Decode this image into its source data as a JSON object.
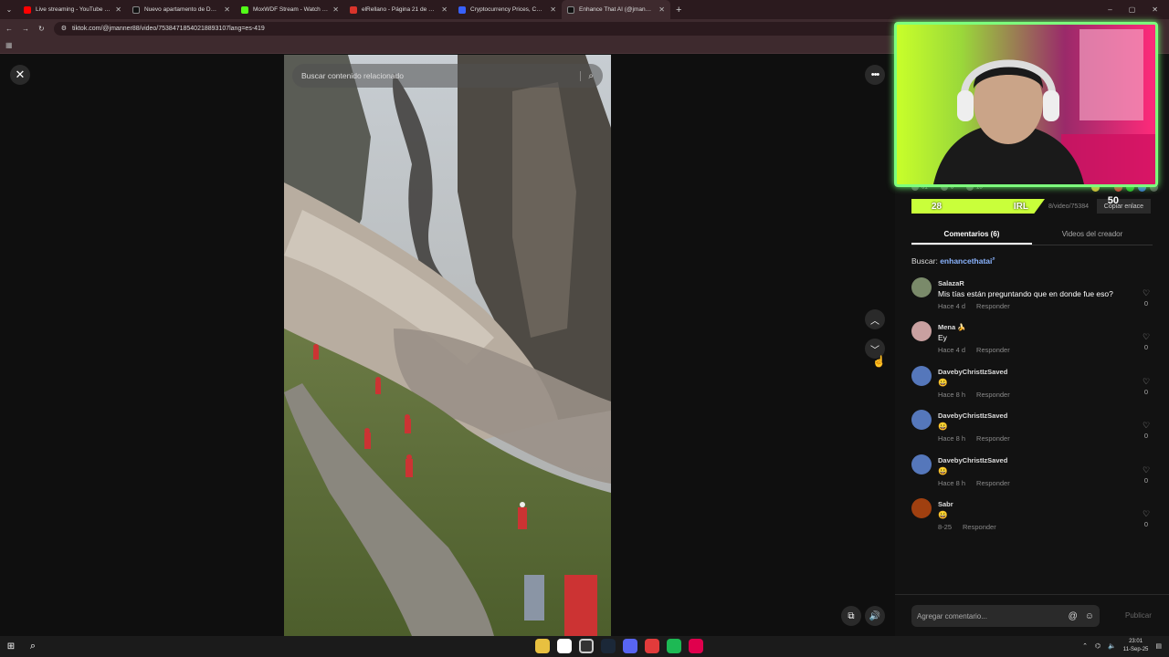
{
  "browser": {
    "tabs": [
      {
        "title": "Live streaming - YouTube Studio",
        "color": "#ff0000"
      },
      {
        "title": "Nuevo apartamento de Daarick",
        "color": "#000000"
      },
      {
        "title": "MoxWDF Stream - Watch Live on",
        "color": "#53fc18"
      },
      {
        "title": "elRellano - Página 21 de 5725",
        "color": "#d9342b"
      },
      {
        "title": "Cryptocurrency Prices, Charts A",
        "color": "#3861fb"
      },
      {
        "title": "Enhance That AI (@jmanner8",
        "color": "#000000",
        "active": true
      }
    ],
    "url": "tiktok.com/@jmanner88/video/75384718540218893107lang=es-419",
    "window": {
      "min": "–",
      "max": "▢",
      "close": "✕"
    }
  },
  "player": {
    "search_placeholder": "Buscar contenido relacionado",
    "more": "•••",
    "up": "︿",
    "down": "﹀",
    "close": "✕"
  },
  "panel": {
    "stats": [
      "61",
      "6",
      "13",
      "1/7"
    ],
    "overlay_left": "28",
    "overlay_right": "IRL",
    "link_text": "8/video/75384",
    "copy_label": "Copiar enlace",
    "copy_number": "50",
    "tabs": {
      "comments": "Comentarios (6)",
      "creator": "Videos del creador"
    },
    "search_prefix": "Buscar:",
    "search_query": "enhancethatai",
    "comments": [
      {
        "user": "SalazaR",
        "text": "Mis tías están preguntando que en donde fue eso?",
        "time": "Hace 4 d",
        "reply": "Responder",
        "likes": "0",
        "avatar_color": "#7a8a6a"
      },
      {
        "user": "Mena 🍌",
        "text": "Ey",
        "time": "Hace 4 d",
        "reply": "Responder",
        "likes": "0",
        "avatar_color": "#c9a0a0"
      },
      {
        "user": "DavebyChristIzSaved",
        "text": "😀",
        "time": "Hace 8 h",
        "reply": "Responder",
        "likes": "0",
        "avatar_color": "#5577bb"
      },
      {
        "user": "DavebyChristIzSaved",
        "text": "😀",
        "time": "Hace 8 h",
        "reply": "Responder",
        "likes": "0",
        "avatar_color": "#5577bb"
      },
      {
        "user": "DavebyChristIzSaved",
        "text": "😀",
        "time": "Hace 8 h",
        "reply": "Responder",
        "likes": "0",
        "avatar_color": "#5577bb"
      },
      {
        "user": "Sabr",
        "text": "😀",
        "time": "8-25",
        "reply": "Responder",
        "likes": "0",
        "avatar_color": "#a04010"
      }
    ],
    "comment_placeholder": "Agregar comentario...",
    "publish": "Publicar"
  },
  "taskbar": {
    "time": "23:01",
    "date": "11-Sep-25",
    "apps": [
      "#e8c040",
      "#ffffff",
      "#d83b01",
      "#1b2838",
      "#5865f2",
      "#e23b3b",
      "#1db954",
      "#e0004d"
    ]
  }
}
